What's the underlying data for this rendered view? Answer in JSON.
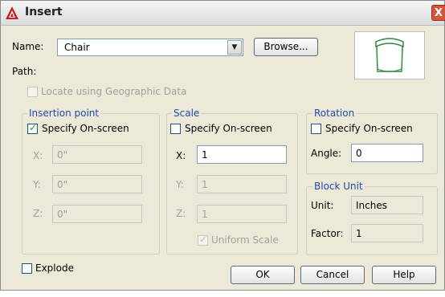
{
  "window": {
    "title": "Insert",
    "close_glyph": "X"
  },
  "name": {
    "label": "Name:",
    "value": "Chair",
    "browse_label": "Browse..."
  },
  "path": {
    "label": "Path:"
  },
  "geo": {
    "label": "Locate using Geographic Data",
    "checked": false
  },
  "insertion": {
    "title": "Insertion point",
    "specify_label": "Specify On-screen",
    "specify_checked": true,
    "x_label": "X:",
    "x_value": "0\"",
    "y_label": "Y:",
    "y_value": "0\"",
    "z_label": "Z:",
    "z_value": "0\""
  },
  "scale": {
    "title": "Scale",
    "specify_label": "Specify On-screen",
    "specify_checked": false,
    "x_label": "X:",
    "x_value": "1",
    "y_label": "Y:",
    "y_value": "1",
    "z_label": "Z:",
    "z_value": "1",
    "uniform_label": "Uniform Scale",
    "uniform_checked": true
  },
  "rotation": {
    "title": "Rotation",
    "specify_label": "Specify On-screen",
    "specify_checked": false,
    "angle_label": "Angle:",
    "angle_value": "0"
  },
  "block_unit": {
    "title": "Block Unit",
    "unit_label": "Unit:",
    "unit_value": "Inches",
    "factor_label": "Factor:",
    "factor_value": "1"
  },
  "explode": {
    "label": "Explode",
    "checked": false
  },
  "buttons": {
    "ok": "OK",
    "cancel": "Cancel",
    "help": "Help"
  },
  "icons": {
    "app": "autocad-icon",
    "check": "check-mark-icon",
    "dropdown": "chevron-down-icon"
  },
  "colors": {
    "group_title": "#1f4aa8",
    "check_mark": "#21a121",
    "close_button": "#d6543a",
    "preview_symbol": "#2e8a3e"
  }
}
